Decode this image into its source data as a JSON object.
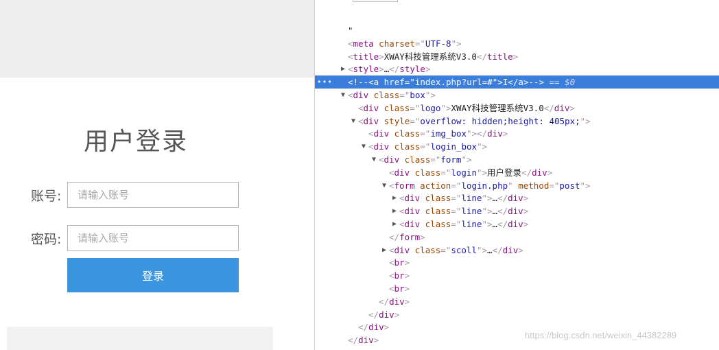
{
  "login": {
    "title": "用户登录",
    "username_label": "账号:",
    "username_placeholder": "请输入账号",
    "password_label": "密码:",
    "password_placeholder": "请输入账号",
    "submit_label": "登录"
  },
  "devtools": {
    "selected_suffix": "== $0",
    "lines": [
      {
        "indent": 0,
        "toggle": "",
        "raw": "\""
      },
      {
        "indent": 0,
        "toggle": "",
        "parts": [
          [
            "tag",
            "<"
          ],
          [
            "tname",
            "meta"
          ],
          [
            "txt",
            " "
          ],
          [
            "attr",
            "charset"
          ],
          [
            "tag",
            "=\""
          ],
          [
            "aval",
            "UTF-8"
          ],
          [
            "tag",
            "\">"
          ]
        ]
      },
      {
        "indent": 0,
        "toggle": "",
        "parts": [
          [
            "tag",
            "<"
          ],
          [
            "tname",
            "title"
          ],
          [
            "tag",
            ">"
          ],
          [
            "txt",
            "XWAY科技管理系统V3.0"
          ],
          [
            "tag",
            "</"
          ],
          [
            "tname",
            "title"
          ],
          [
            "tag",
            ">"
          ]
        ]
      },
      {
        "indent": 0,
        "toggle": "▶",
        "parts": [
          [
            "tag",
            "<"
          ],
          [
            "tname",
            "style"
          ],
          [
            "tag",
            ">"
          ],
          [
            "txt",
            "…"
          ],
          [
            "tag",
            "</"
          ],
          [
            "tname",
            "style"
          ],
          [
            "tag",
            ">"
          ]
        ]
      },
      {
        "indent": 0,
        "toggle": "",
        "selected": true,
        "parts": [
          [
            "comment",
            "<!--<a href=\"index.php?url=#\">I</a>-->"
          ]
        ]
      },
      {
        "indent": 0,
        "toggle": "▼",
        "parts": [
          [
            "tag",
            "<"
          ],
          [
            "tname",
            "div"
          ],
          [
            "txt",
            " "
          ],
          [
            "attr",
            "class"
          ],
          [
            "tag",
            "=\""
          ],
          [
            "aval",
            "box"
          ],
          [
            "tag",
            "\">"
          ]
        ]
      },
      {
        "indent": 1,
        "toggle": "",
        "parts": [
          [
            "tag",
            "<"
          ],
          [
            "tname",
            "div"
          ],
          [
            "txt",
            " "
          ],
          [
            "attr",
            "class"
          ],
          [
            "tag",
            "=\""
          ],
          [
            "aval",
            "logo"
          ],
          [
            "tag",
            "\">"
          ],
          [
            "txt",
            "XWAY科技管理系统V3.0"
          ],
          [
            "tag",
            "</"
          ],
          [
            "tname",
            "div"
          ],
          [
            "tag",
            ">"
          ]
        ]
      },
      {
        "indent": 1,
        "toggle": "▼",
        "parts": [
          [
            "tag",
            "<"
          ],
          [
            "tname",
            "div"
          ],
          [
            "txt",
            " "
          ],
          [
            "attr",
            "style"
          ],
          [
            "tag",
            "=\""
          ],
          [
            "aval",
            "overflow: hidden;height: 405px;"
          ],
          [
            "tag",
            "\">"
          ]
        ]
      },
      {
        "indent": 2,
        "toggle": "",
        "parts": [
          [
            "tag",
            "<"
          ],
          [
            "tname",
            "div"
          ],
          [
            "txt",
            " "
          ],
          [
            "attr",
            "class"
          ],
          [
            "tag",
            "=\""
          ],
          [
            "aval",
            "img_box"
          ],
          [
            "tag",
            "\"></"
          ],
          [
            "tname",
            "div"
          ],
          [
            "tag",
            ">"
          ]
        ]
      },
      {
        "indent": 2,
        "toggle": "▼",
        "parts": [
          [
            "tag",
            "<"
          ],
          [
            "tname",
            "div"
          ],
          [
            "txt",
            " "
          ],
          [
            "attr",
            "class"
          ],
          [
            "tag",
            "=\""
          ],
          [
            "aval",
            "login_box"
          ],
          [
            "tag",
            "\">"
          ]
        ]
      },
      {
        "indent": 3,
        "toggle": "▼",
        "parts": [
          [
            "tag",
            "<"
          ],
          [
            "tname",
            "div"
          ],
          [
            "txt",
            " "
          ],
          [
            "attr",
            "class"
          ],
          [
            "tag",
            "=\""
          ],
          [
            "aval",
            "form"
          ],
          [
            "tag",
            "\">"
          ]
        ]
      },
      {
        "indent": 4,
        "toggle": "",
        "parts": [
          [
            "tag",
            "<"
          ],
          [
            "tname",
            "div"
          ],
          [
            "txt",
            " "
          ],
          [
            "attr",
            "class"
          ],
          [
            "tag",
            "=\""
          ],
          [
            "aval",
            "login"
          ],
          [
            "tag",
            "\">"
          ],
          [
            "txt",
            "用户登录"
          ],
          [
            "tag",
            "</"
          ],
          [
            "tname",
            "div"
          ],
          [
            "tag",
            ">"
          ]
        ]
      },
      {
        "indent": 4,
        "toggle": "▼",
        "parts": [
          [
            "tag",
            "<"
          ],
          [
            "tname",
            "form"
          ],
          [
            "txt",
            " "
          ],
          [
            "attr",
            "action"
          ],
          [
            "tag",
            "=\""
          ],
          [
            "aval",
            "login.php"
          ],
          [
            "tag",
            "\""
          ],
          [
            "txt",
            " "
          ],
          [
            "attr",
            "method"
          ],
          [
            "tag",
            "=\""
          ],
          [
            "aval",
            "post"
          ],
          [
            "tag",
            "\">"
          ]
        ]
      },
      {
        "indent": 5,
        "toggle": "▶",
        "parts": [
          [
            "tag",
            "<"
          ],
          [
            "tname",
            "div"
          ],
          [
            "txt",
            " "
          ],
          [
            "attr",
            "class"
          ],
          [
            "tag",
            "=\""
          ],
          [
            "aval",
            "line"
          ],
          [
            "tag",
            "\">"
          ],
          [
            "txt",
            "…"
          ],
          [
            "tag",
            "</"
          ],
          [
            "tname",
            "div"
          ],
          [
            "tag",
            ">"
          ]
        ]
      },
      {
        "indent": 5,
        "toggle": "▶",
        "parts": [
          [
            "tag",
            "<"
          ],
          [
            "tname",
            "div"
          ],
          [
            "txt",
            " "
          ],
          [
            "attr",
            "class"
          ],
          [
            "tag",
            "=\""
          ],
          [
            "aval",
            "line"
          ],
          [
            "tag",
            "\">"
          ],
          [
            "txt",
            "…"
          ],
          [
            "tag",
            "</"
          ],
          [
            "tname",
            "div"
          ],
          [
            "tag",
            ">"
          ]
        ]
      },
      {
        "indent": 5,
        "toggle": "▶",
        "parts": [
          [
            "tag",
            "<"
          ],
          [
            "tname",
            "div"
          ],
          [
            "txt",
            " "
          ],
          [
            "attr",
            "class"
          ],
          [
            "tag",
            "=\""
          ],
          [
            "aval",
            "line"
          ],
          [
            "tag",
            "\">"
          ],
          [
            "txt",
            "…"
          ],
          [
            "tag",
            "</"
          ],
          [
            "tname",
            "div"
          ],
          [
            "tag",
            ">"
          ]
        ]
      },
      {
        "indent": 4,
        "toggle": "",
        "parts": [
          [
            "tag",
            "</"
          ],
          [
            "tname",
            "form"
          ],
          [
            "tag",
            ">"
          ]
        ]
      },
      {
        "indent": 4,
        "toggle": "▶",
        "parts": [
          [
            "tag",
            "<"
          ],
          [
            "tname",
            "div"
          ],
          [
            "txt",
            " "
          ],
          [
            "attr",
            "class"
          ],
          [
            "tag",
            "=\""
          ],
          [
            "aval",
            "scoll"
          ],
          [
            "tag",
            "\">"
          ],
          [
            "txt",
            "…"
          ],
          [
            "tag",
            "</"
          ],
          [
            "tname",
            "div"
          ],
          [
            "tag",
            ">"
          ]
        ]
      },
      {
        "indent": 4,
        "toggle": "",
        "parts": [
          [
            "tag",
            "<"
          ],
          [
            "tname",
            "br"
          ],
          [
            "tag",
            ">"
          ]
        ]
      },
      {
        "indent": 4,
        "toggle": "",
        "parts": [
          [
            "tag",
            "<"
          ],
          [
            "tname",
            "br"
          ],
          [
            "tag",
            ">"
          ]
        ]
      },
      {
        "indent": 4,
        "toggle": "",
        "parts": [
          [
            "tag",
            "<"
          ],
          [
            "tname",
            "br"
          ],
          [
            "tag",
            ">"
          ]
        ]
      },
      {
        "indent": 3,
        "toggle": "",
        "parts": [
          [
            "tag",
            "</"
          ],
          [
            "tname",
            "div"
          ],
          [
            "tag",
            ">"
          ]
        ]
      },
      {
        "indent": 2,
        "toggle": "",
        "parts": [
          [
            "tag",
            "</"
          ],
          [
            "tname",
            "div"
          ],
          [
            "tag",
            ">"
          ]
        ]
      },
      {
        "indent": 1,
        "toggle": "",
        "parts": [
          [
            "tag",
            "</"
          ],
          [
            "tname",
            "div"
          ],
          [
            "tag",
            ">"
          ]
        ]
      },
      {
        "indent": 0,
        "toggle": "",
        "parts": [
          [
            "tag",
            "</"
          ],
          [
            "tname",
            "div"
          ],
          [
            "tag",
            ">"
          ]
        ]
      }
    ]
  },
  "watermark": "https://blog.csdn.net/weixin_44382289"
}
